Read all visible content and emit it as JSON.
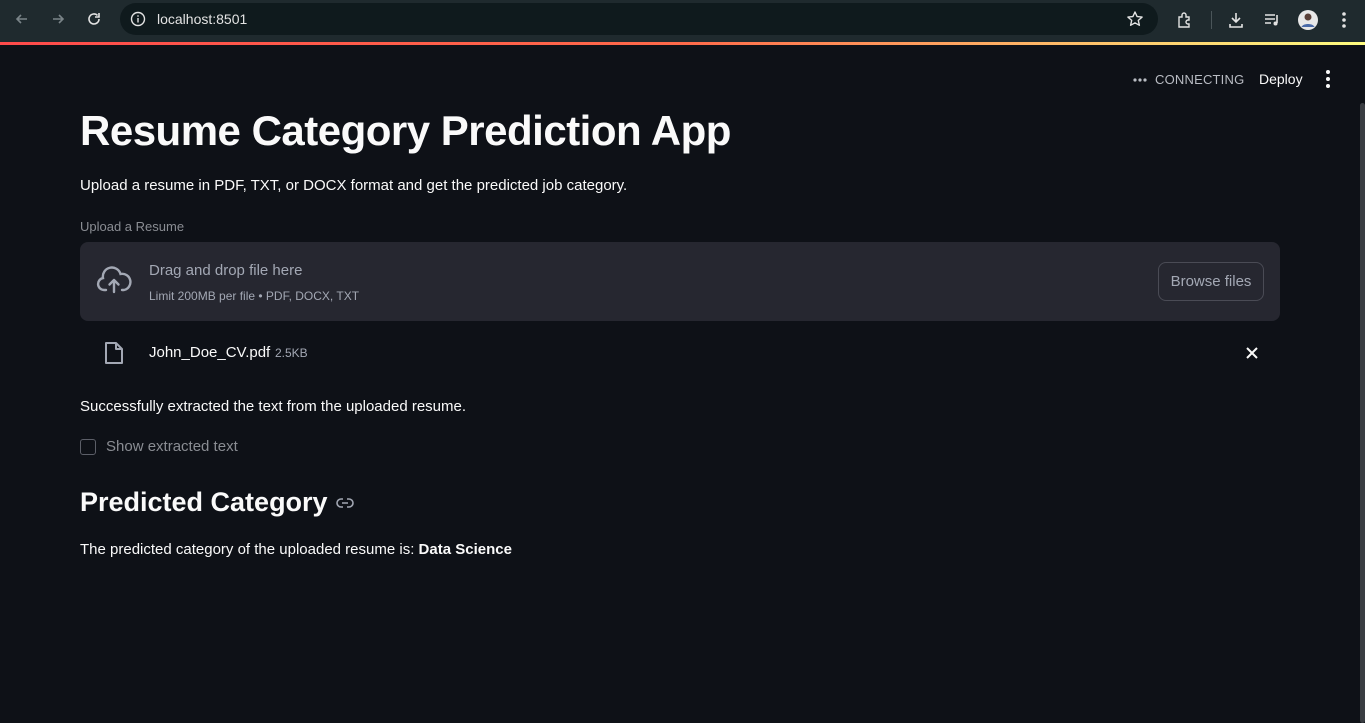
{
  "browser": {
    "url": "localhost:8501"
  },
  "header": {
    "status_text": "CONNECTING",
    "deploy_label": "Deploy"
  },
  "main": {
    "title": "Resume Category Prediction App",
    "subtitle": "Upload a resume in PDF, TXT, or DOCX format and get the predicted job category.",
    "uploader": {
      "label": "Upload a Resume",
      "drop_text": "Drag and drop file here",
      "limit_text": "Limit 200MB per file • PDF, DOCX, TXT",
      "browse_label": "Browse files"
    },
    "uploaded_file": {
      "name": "John_Doe_CV.pdf",
      "size": "2.5KB"
    },
    "success_message": "Successfully extracted the text from the uploaded resume.",
    "checkbox_label": "Show extracted text",
    "section_heading": "Predicted Category",
    "result_prefix": "The predicted category of the uploaded resume is:",
    "result_value": "Data Science"
  },
  "colors": {
    "background": "#0e1117",
    "surface": "#262730",
    "text": "#fafafa",
    "muted": "#a3a8b4",
    "accent": "#ff4b4b"
  }
}
